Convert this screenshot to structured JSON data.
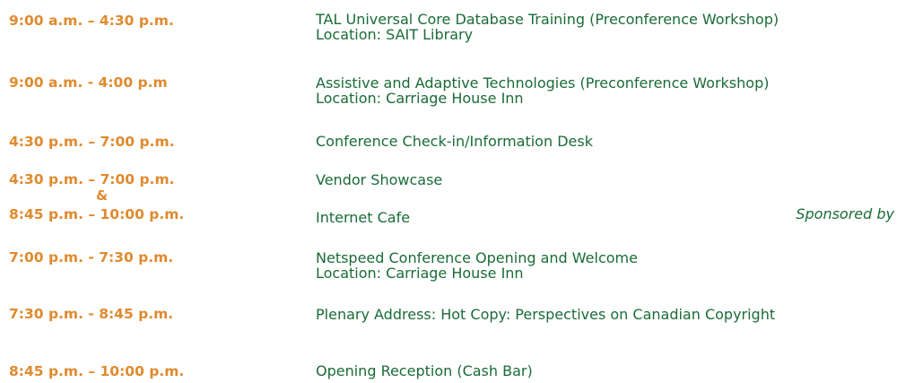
{
  "schedule": [
    {
      "time": "9:00 a.m. – 4:30 p.m.",
      "event_lines": [
        "TAL Universal Core Database Training (Preconference Workshop)",
        "Location: SAIT Library"
      ]
    },
    {
      "time": "9:00 a.m. - 4:00 p.m",
      "event_lines": [
        "Assistive and Adaptive Technologies (Preconference Workshop)",
        "Location: Carriage House Inn"
      ]
    },
    {
      "time": "4:30 p.m. – 7:00 p.m.",
      "event_lines": [
        "Conference Check-in/Information Desk"
      ]
    },
    {
      "time": "4:30 p.m. – 7:00 p.m.",
      "event_lines": [
        "Vendor Showcase"
      ]
    },
    {
      "connector": "&"
    },
    {
      "time": "8:45 p.m. – 10:00 p.m.",
      "event_lines": [
        "Internet Cafe"
      ],
      "note": "Sponsored by"
    },
    {
      "time": "7:00 p.m. - 7:30 p.m.",
      "event_lines": [
        "Netspeed Conference Opening and Welcome",
        "Location: Carriage House Inn"
      ]
    },
    {
      "time": "7:30 p.m. - 8:45 p.m.",
      "event_lines": [
        "Plenary Address: Hot Copy: Perspectives on Canadian Copyright"
      ]
    },
    {
      "time": "8:45 p.m. – 10:00 p.m.",
      "event_lines": [
        "Opening Reception (Cash Bar)"
      ]
    }
  ]
}
